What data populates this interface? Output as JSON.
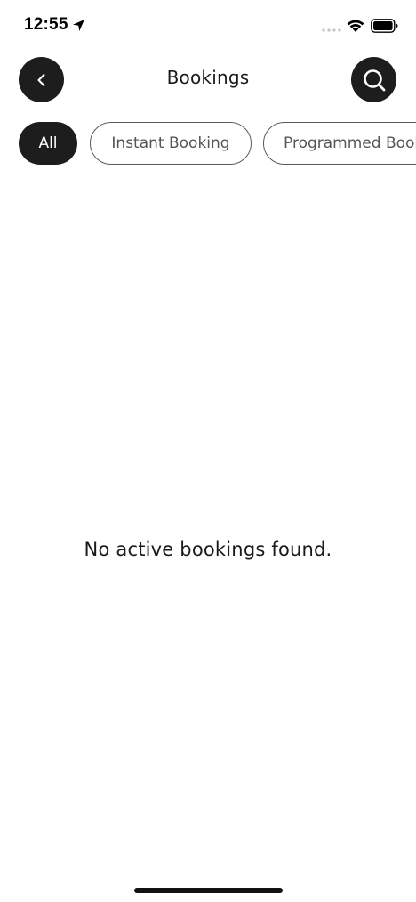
{
  "status_bar": {
    "time": "12:55",
    "icons": [
      "location-arrow-icon",
      "cellular-signal-icon",
      "wifi-icon",
      "battery-icon"
    ]
  },
  "header": {
    "title": "Bookings",
    "back_icon": "chevron-left-icon",
    "search_icon": "search-icon"
  },
  "filters": {
    "selected": "All",
    "items": [
      {
        "label": "All",
        "active": true
      },
      {
        "label": "Instant Booking",
        "active": false
      },
      {
        "label": "Programmed Bookings",
        "active": false
      }
    ]
  },
  "empty_state": {
    "message": "No active bookings found."
  },
  "colors": {
    "accent_dark": "#1d1d1d",
    "background": "#ffffff",
    "chip_border": "#5a5a5a",
    "chip_text": "#555555"
  }
}
